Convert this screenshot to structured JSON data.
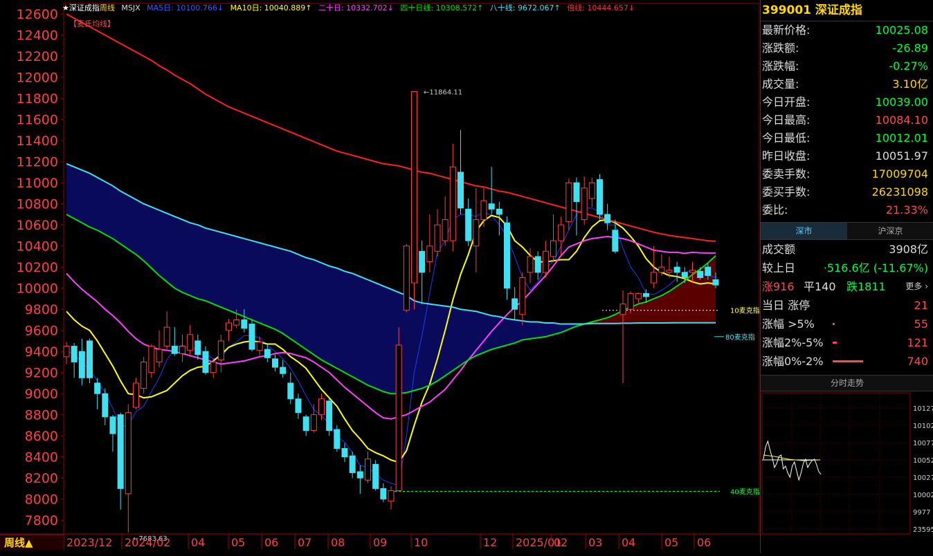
{
  "header": {
    "star_title": "★深证成指",
    "period": "周线",
    "indicator": "MSJX",
    "ma5": "MA5日: 10100.766↓",
    "ma10": "MA10日: 10040.889↑",
    "ma20": "二十日: 10332.702↓",
    "ma40": "四十日线: 10308.572↑",
    "ma80": "八十线: 9672.067↑",
    "ma_x": "倍线: 10444.657↓"
  },
  "legend_label": "【麦氏均线】",
  "chart_data": {
    "type": "candlestick",
    "title": "深证成指 周线",
    "y_ticks": [
      12600,
      12400,
      12200,
      12000,
      11800,
      11600,
      11400,
      11200,
      11000,
      10800,
      10600,
      10400,
      10200,
      10000,
      9800,
      9600,
      9400,
      9200,
      9000,
      8800,
      8600,
      8400,
      8200,
      8000,
      7800
    ],
    "ylim": [
      7670,
      12700
    ],
    "x_labels": [
      "2023/12",
      "2024/02",
      "04",
      "05",
      "06",
      "07",
      "08",
      "09",
      "10",
      "12",
      "2025/01",
      "02",
      "03",
      "04",
      "05",
      "06"
    ],
    "annotations": {
      "high": {
        "label": "11864.11",
        "value": 11864.11
      },
      "low": {
        "label": "7683.63",
        "value": 7683.63
      },
      "mk10": {
        "label": "10麦克指",
        "value": 9790
      },
      "mk80": {
        "label": "80麦克指",
        "value": 9540
      },
      "mk40": {
        "label": "40麦克指",
        "value": 8073
      }
    },
    "candles": [
      [
        9350,
        9450,
        9490,
        9280
      ],
      [
        9450,
        9300,
        9480,
        9150
      ],
      [
        9400,
        9150,
        9520,
        9080
      ],
      [
        9500,
        9150,
        9520,
        9100
      ],
      [
        9100,
        9000,
        9150,
        8850
      ],
      [
        9000,
        8780,
        9050,
        8700
      ],
      [
        8780,
        8620,
        8800,
        8450
      ],
      [
        8800,
        8100,
        8820,
        7900
      ],
      [
        8050,
        8820,
        8900,
        7683.63
      ],
      [
        8870,
        9100,
        9150,
        8850
      ],
      [
        9050,
        9300,
        9350,
        9000
      ],
      [
        9200,
        9450,
        9470,
        9150
      ],
      [
        9300,
        9420,
        9600,
        9250
      ],
      [
        9450,
        9630,
        9780,
        9420
      ],
      [
        9450,
        9380,
        9630,
        9360
      ],
      [
        9380,
        9450,
        9560,
        9300
      ],
      [
        9410,
        9560,
        9650,
        9350
      ],
      [
        9500,
        9370,
        9560,
        9320
      ],
      [
        9400,
        9200,
        9450,
        9180
      ],
      [
        9200,
        9300,
        9330,
        9150
      ],
      [
        9320,
        9500,
        9560,
        9200
      ],
      [
        9600,
        9670,
        9710,
        9500
      ],
      [
        9650,
        9700,
        9800,
        9620
      ],
      [
        9700,
        9620,
        9800,
        9580
      ],
      [
        9660,
        9420,
        9700,
        9400
      ],
      [
        9410,
        9490,
        9540,
        9360
      ],
      [
        9420,
        9340,
        9470,
        9300
      ],
      [
        9330,
        9250,
        9370,
        9210
      ],
      [
        9250,
        9190,
        9320,
        9150
      ],
      [
        9100,
        8950,
        9200,
        8900
      ],
      [
        8950,
        8820,
        9000,
        8760
      ],
      [
        8780,
        8650,
        8800,
        8600
      ],
      [
        8650,
        8800,
        8900,
        8630
      ],
      [
        8800,
        8950,
        9000,
        8750
      ],
      [
        8930,
        8650,
        8950,
        8600
      ],
      [
        8660,
        8480,
        8700,
        8450
      ],
      [
        8480,
        8400,
        8530,
        8350
      ],
      [
        8410,
        8250,
        8450,
        8200
      ],
      [
        8260,
        8200,
        8320,
        8050
      ],
      [
        8180,
        8380,
        8450,
        8150
      ],
      [
        8330,
        8100,
        8370,
        8080
      ],
      [
        8100,
        8000,
        8150,
        7970
      ],
      [
        7980,
        8080,
        8120,
        7900
      ],
      [
        8080,
        9460,
        9630,
        8070
      ],
      [
        9790,
        10400,
        10420,
        9770
      ],
      [
        10050,
        11864.11,
        11870,
        9800
      ],
      [
        10350,
        10150,
        10450,
        9850
      ],
      [
        10250,
        10400,
        10700,
        10150
      ],
      [
        10350,
        10600,
        10750,
        10300
      ],
      [
        10450,
        10650,
        10870,
        10400
      ],
      [
        10450,
        11150,
        11370,
        10350
      ],
      [
        11100,
        10760,
        11500,
        10700
      ],
      [
        10750,
        10450,
        10850,
        10400
      ],
      [
        10400,
        10650,
        10950,
        10150
      ],
      [
        10650,
        10830,
        10950,
        10580
      ],
      [
        10800,
        10750,
        11150,
        10700
      ],
      [
        10750,
        10700,
        10820,
        10500
      ],
      [
        10620,
        10000,
        10680,
        9890
      ],
      [
        9900,
        9800,
        10010,
        9700
      ],
      [
        9750,
        10100,
        10150,
        9650
      ],
      [
        10150,
        10300,
        10380,
        10050
      ],
      [
        10300,
        10150,
        10350,
        10080
      ],
      [
        10150,
        10350,
        10450,
        10100
      ],
      [
        10300,
        10450,
        10700,
        10250
      ],
      [
        10450,
        10600,
        10680,
        10300
      ],
      [
        10630,
        11000,
        11040,
        10550
      ],
      [
        11000,
        10820,
        11050,
        10500
      ],
      [
        10650,
        10950,
        11060,
        10600
      ],
      [
        10850,
        11000,
        11050,
        10770
      ],
      [
        11030,
        10700,
        11080,
        10650
      ],
      [
        10700,
        10620,
        10800,
        10550
      ],
      [
        10550,
        10350,
        10650,
        10330
      ],
      [
        9750,
        9850,
        9980,
        9100
      ],
      [
        9800,
        9950,
        9970,
        9760
      ],
      [
        9900,
        9950,
        9960,
        9850
      ],
      [
        9950,
        9920,
        9990,
        9860
      ],
      [
        10050,
        10150,
        10400,
        10000
      ],
      [
        10150,
        10200,
        10320,
        10120
      ],
      [
        10150,
        10170,
        10300,
        10100
      ],
      [
        10200,
        10150,
        10250,
        10060
      ],
      [
        10150,
        10100,
        10200,
        10050
      ],
      [
        10150,
        10170,
        10250,
        10060
      ],
      [
        10160,
        10100,
        10200,
        10080
      ],
      [
        10200,
        10120,
        10240,
        10080
      ],
      [
        10080,
        10030,
        10150,
        10000
      ]
    ],
    "lines": [
      {
        "name": "MA5",
        "color": "#1e3cff",
        "values": [
          9400,
          9380,
          9290,
          9230,
          9120,
          9010,
          8860,
          8690,
          8700,
          8830,
          8880,
          9020,
          9150,
          9320,
          9430,
          9460,
          9420,
          9430,
          9380,
          9330,
          9340,
          9440,
          9490,
          9550,
          9550,
          9530,
          9460,
          9400,
          9330,
          9240,
          9120,
          8980,
          8850,
          8790,
          8720,
          8590,
          8540,
          8440,
          8320,
          8300,
          8240,
          8180,
          8150,
          8130,
          8600,
          9200,
          9550,
          9950,
          10340,
          10450,
          10650,
          10700,
          10700,
          10680,
          10720,
          10690,
          10600,
          10490,
          10300,
          10100,
          9980,
          10060,
          10200,
          10250,
          10400,
          10550,
          10700,
          10760,
          10760,
          10720,
          10600,
          10600,
          10380,
          10200,
          10100,
          9950,
          9940,
          9980,
          10030,
          10100,
          10150,
          10170,
          10150,
          10120,
          10100
        ]
      },
      {
        "name": "MA10",
        "color": "#ffff00",
        "values": [
          9780,
          9700,
          9640,
          9600,
          9500,
          9380,
          9260,
          9120,
          9000,
          8990,
          8960,
          8970,
          9000,
          9030,
          9100,
          9170,
          9220,
          9250,
          9260,
          9310,
          9370,
          9440,
          9470,
          9490,
          9500,
          9490,
          9470,
          9470,
          9420,
          9350,
          9300,
          9240,
          9140,
          9040,
          8960,
          8880,
          8760,
          8650,
          8570,
          8480,
          8440,
          8410,
          8370,
          8350,
          8460,
          8700,
          8920,
          9090,
          9330,
          9600,
          9890,
          10130,
          10320,
          10540,
          10640,
          10690,
          10670,
          10590,
          10450,
          10390,
          10310,
          10250,
          10250,
          10260,
          10270,
          10270,
          10350,
          10480,
          10580,
          10640,
          10650,
          10620,
          10570,
          10490,
          10400,
          10280,
          10200,
          10150,
          10120,
          10110,
          10090,
          10060,
          10040,
          10050,
          10040
        ]
      },
      {
        "name": "MA20",
        "color": "#ff40ff",
        "values": [
          10140,
          10060,
          9990,
          9930,
          9870,
          9800,
          9740,
          9670,
          9590,
          9520,
          9470,
          9440,
          9420,
          9410,
          9400,
          9380,
          9360,
          9340,
          9320,
          9300,
          9280,
          9290,
          9300,
          9310,
          9330,
          9350,
          9360,
          9380,
          9390,
          9380,
          9360,
          9340,
          9300,
          9250,
          9200,
          9130,
          9060,
          9000,
          8940,
          8880,
          8820,
          8770,
          8760,
          8780,
          8800,
          8840,
          8880,
          8920,
          8980,
          9040,
          9130,
          9220,
          9320,
          9410,
          9500,
          9590,
          9670,
          9750,
          9820,
          9880,
          9960,
          10040,
          10120,
          10210,
          10310,
          10390,
          10420,
          10450,
          10470,
          10480,
          10490,
          10480,
          10470,
          10450,
          10420,
          10390,
          10360,
          10350,
          10340,
          10340,
          10330,
          10340,
          10335,
          10333,
          10333
        ]
      },
      {
        "name": "MA40",
        "color": "#00e000",
        "values": [
          10700,
          10660,
          10620,
          10580,
          10550,
          10510,
          10470,
          10420,
          10370,
          10320,
          10260,
          10190,
          10120,
          10060,
          10000,
          9960,
          9930,
          9900,
          9880,
          9850,
          9820,
          9790,
          9760,
          9730,
          9700,
          9670,
          9640,
          9610,
          9570,
          9520,
          9470,
          9420,
          9370,
          9320,
          9280,
          9240,
          9200,
          9160,
          9120,
          9080,
          9050,
          9020,
          9000,
          9000,
          9010,
          9030,
          9050,
          9080,
          9120,
          9170,
          9220,
          9270,
          9320,
          9360,
          9390,
          9420,
          9440,
          9460,
          9480,
          9510,
          9520,
          9530,
          9540,
          9560,
          9580,
          9610,
          9640,
          9660,
          9680,
          9700,
          9720,
          9750,
          9790,
          9820,
          9850,
          9870,
          9900,
          9930,
          9970,
          10020,
          10070,
          10130,
          10180,
          10240,
          10308
        ]
      },
      {
        "name": "MA80",
        "color": "#40e0f0",
        "values": [
          11180,
          11150,
          11120,
          11090,
          11050,
          11010,
          10970,
          10920,
          10880,
          10840,
          10800,
          10770,
          10740,
          10710,
          10680,
          10650,
          10620,
          10600,
          10570,
          10550,
          10530,
          10510,
          10490,
          10470,
          10450,
          10430,
          10410,
          10390,
          10370,
          10350,
          10320,
          10290,
          10270,
          10240,
          10210,
          10190,
          10160,
          10140,
          10110,
          10080,
          10050,
          10020,
          9990,
          9960,
          9930,
          9880,
          9860,
          9850,
          9840,
          9830,
          9820,
          9800,
          9790,
          9780,
          9760,
          9740,
          9730,
          9710,
          9700,
          9690,
          9680,
          9680,
          9670,
          9670,
          9660,
          9660,
          9660,
          9660,
          9665,
          9665,
          9665,
          9665,
          9668,
          9668,
          9670,
          9670,
          9670,
          9670,
          9671,
          9672,
          9672,
          9672,
          9672,
          9672,
          9672
        ]
      },
      {
        "name": "MAX",
        "color": "#ff2020",
        "values": [
          12600,
          12560,
          12520,
          12480,
          12440,
          12400,
          12360,
          12320,
          12280,
          12240,
          12200,
          12160,
          12110,
          12070,
          12020,
          11980,
          11940,
          11890,
          11840,
          11800,
          11760,
          11720,
          11690,
          11660,
          11630,
          11600,
          11570,
          11540,
          11510,
          11480,
          11450,
          11420,
          11390,
          11360,
          11330,
          11300,
          11280,
          11260,
          11240,
          11220,
          11200,
          11180,
          11170,
          11160,
          11140,
          11120,
          11100,
          11090,
          11070,
          11050,
          11030,
          11010,
          10990,
          10970,
          10960,
          10940,
          10920,
          10910,
          10890,
          10870,
          10850,
          10830,
          10810,
          10790,
          10770,
          10750,
          10730,
          10710,
          10690,
          10670,
          10650,
          10630,
          10610,
          10590,
          10570,
          10550,
          10530,
          10515,
          10500,
          10490,
          10480,
          10470,
          10460,
          10450,
          10445
        ]
      }
    ]
  },
  "right_panel": {
    "code_title": "399001 深证成指",
    "rows": [
      {
        "label": "最新价格:",
        "value": "10025.08",
        "color": "#00ff40"
      },
      {
        "label": "涨跌额:",
        "value": "-26.89",
        "color": "#00ff40"
      },
      {
        "label": "涨跌幅:",
        "value": "-0.27%",
        "color": "#00ff40"
      },
      {
        "label": "成交量:",
        "value": "3.10亿",
        "color": "#ffd700"
      },
      {
        "label": "今日开盘:",
        "value": "10039.00",
        "color": "#00ff40"
      },
      {
        "label": "今日最高:",
        "value": "10084.10",
        "color": "#ff4a4a"
      },
      {
        "label": "今日最低:",
        "value": "10012.01",
        "color": "#00ff40"
      },
      {
        "label": "昨日收盘:",
        "value": "10051.97",
        "color": "#dddddd"
      },
      {
        "label": "委卖手数:",
        "value": "17009704",
        "color": "#ffd700"
      },
      {
        "label": "委买手数:",
        "value": "26231098",
        "color": "#ffd700"
      },
      {
        "label": "委比:",
        "value": "21.33%",
        "color": "#ff4a4a"
      }
    ],
    "tab_active": "深市",
    "tab_inactive": "沪深京",
    "turnover_label": "成交额",
    "turnover_value": "3908亿",
    "compare_label": "较上日",
    "compare_value": "·516.6亿 (-11.67%)",
    "up_label": "涨916",
    "flat_label": "平140",
    "down_label": "跌1811",
    "more_label": "更多 ›",
    "limit_label": "当日 涨停",
    "limit_value": "21",
    "gt5_label": "涨幅 >5%",
    "gt5_value": "55",
    "r25_label": "涨幅2%-5%",
    "r25_value": "121",
    "r02_label": "涨幅0%-2%",
    "r02_value": "740",
    "mini_title": "分时走势",
    "mini_ticks": [
      "10127",
      "10102",
      "10077",
      "10052",
      "10027",
      "10002",
      "9977",
      "23595"
    ]
  },
  "bottom": {
    "period_label": "周线▲"
  }
}
